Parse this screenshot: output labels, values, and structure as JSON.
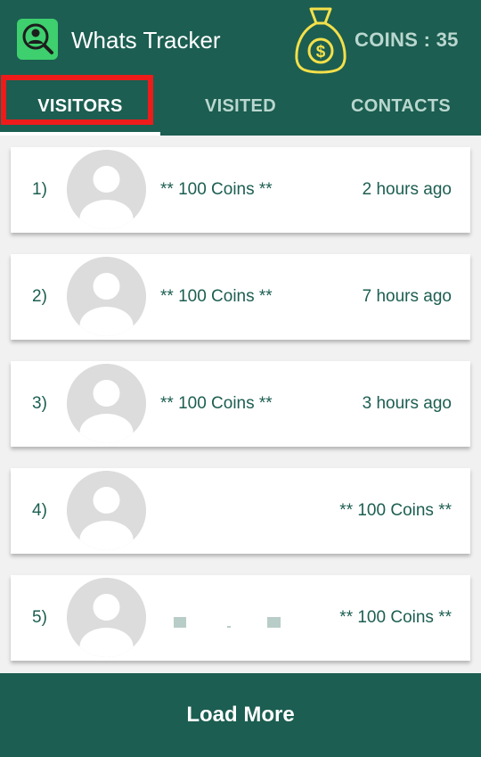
{
  "app": {
    "title": "Whats Tracker",
    "icon": "search-user-icon",
    "coin_icon": "money-bag-icon",
    "coins_label": "COINS : 35"
  },
  "tabs": [
    {
      "label": "VISITORS",
      "active": true
    },
    {
      "label": "VISITED",
      "active": false
    },
    {
      "label": "CONTACTS",
      "active": false
    }
  ],
  "visitors": [
    {
      "num": "1)",
      "coins": "** 100 Coins **",
      "time": "2 hours ago"
    },
    {
      "num": "2)",
      "coins": "** 100 Coins **",
      "time": "7 hours ago"
    },
    {
      "num": "3)",
      "coins": "** 100 Coins **",
      "time": "3 hours ago"
    },
    {
      "num": "4)",
      "coins": "** 100 Coins **"
    },
    {
      "num": "5)",
      "coins": "** 100 Coins **"
    }
  ],
  "load_more": "Load More",
  "colors": {
    "primary": "#1c5e51",
    "icon_green": "#3ecf6e",
    "bag_gold": "#f4e04a",
    "highlight_red": "#ee1b1b"
  }
}
